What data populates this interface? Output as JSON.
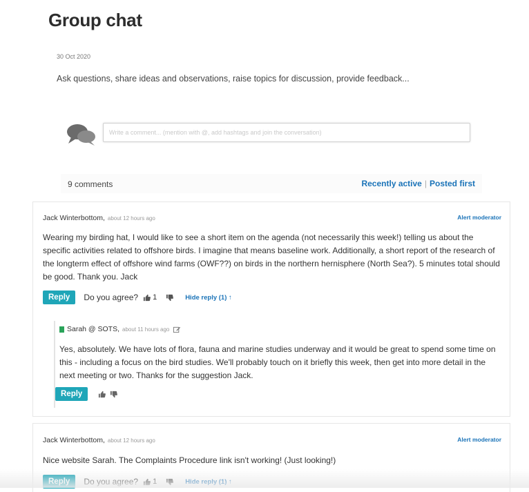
{
  "page": {
    "title": "Group chat",
    "date": "30 Oct 2020",
    "description": "Ask questions, share ideas and observations, raise topics for discussion, provide feedback..."
  },
  "comment_box": {
    "placeholder": "Write a comment... (mention with @, add hashtags and join the conversation)"
  },
  "comments_bar": {
    "count_label": "9 comments",
    "sort_recent": "Recently active",
    "sort_first": "Posted first"
  },
  "comments": [
    {
      "author": "Jack Winterbottom,",
      "ago": "about 12 hours ago",
      "alert_label": "Alert moderator",
      "text": "Wearing my birding hat, I would like to see a short item on the agenda (not necessarily this week!) telling us about the specific activities related to offshore birds. I imagine that means baseline work. Additionally, a short report of the research of the longterm effect of offshore wind farms (OWF??) on birds in the northern hernisphere (North Sea?). 5 minutes total should be good. Thank you. Jack",
      "reply_label": "Reply",
      "agree_label": "Do you agree?",
      "likes": "1",
      "hide_reply_label": "Hide reply (1) ↑",
      "replies": [
        {
          "author": "Sarah @ SOTS,",
          "ago": "about 11 hours ago",
          "text": "Yes, absolutely. We have lots of flora, fauna and marine studies underway and it would be great to spend some time on this - including a focus on the bird studies. We'll probably touch on it briefly this week, then get into more detail in the next meeting or two. Thanks for the suggestion Jack.",
          "reply_label": "Reply"
        }
      ]
    },
    {
      "author": "Jack Winterbottom,",
      "ago": "about 12 hours ago",
      "alert_label": "Alert moderator",
      "text": "Nice website Sarah. The Complaints Procedure link isn't working! (Just looking!)",
      "reply_label": "Reply",
      "agree_label": "Do you agree?",
      "likes": "1",
      "hide_reply_label": "Hide reply (1) ↑"
    }
  ],
  "colors": {
    "accent_link": "#1a73b8",
    "reply_button": "#1fa6b8",
    "moderator_flag": "#2aa35a"
  },
  "icons": [
    "chat-bubbles-icon",
    "thumbs-up-icon",
    "thumbs-down-icon",
    "edit-icon",
    "flag-icon"
  ]
}
